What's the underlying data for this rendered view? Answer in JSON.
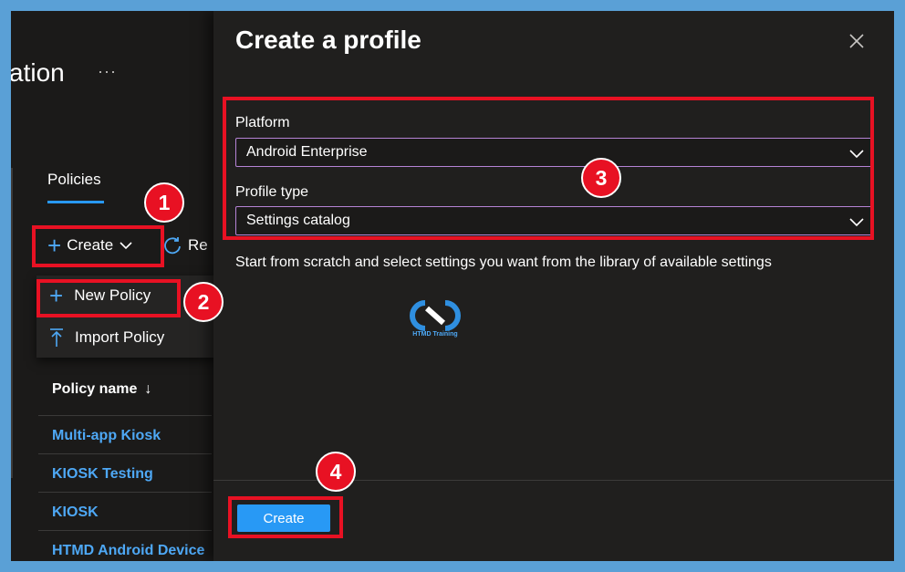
{
  "background": {
    "page_title_fragment": "ation",
    "ellipsis": "···",
    "tab_policies": "Policies",
    "create_menu_label": "Create",
    "refresh_label": "Re",
    "menu": {
      "new_policy": "New Policy",
      "import_policy": "Import Policy"
    },
    "table": {
      "column_header": "Policy name",
      "sort_indicator": "↓",
      "rows": [
        "Multi-app Kiosk",
        "KIOSK Testing",
        "KIOSK",
        "HTMD Android Device"
      ]
    }
  },
  "blade": {
    "title": "Create a profile",
    "close_icon": "close-icon",
    "platform": {
      "label": "Platform",
      "value": "Android Enterprise"
    },
    "profile_type": {
      "label": "Profile type",
      "value": "Settings catalog"
    },
    "helper_text": "Start from scratch and select settings you want from the library of available settings",
    "watermark_text": "HTMD Training",
    "create_button": "Create"
  },
  "annotations": [
    "1",
    "2",
    "3",
    "4"
  ],
  "colors": {
    "accent": "#2899f5",
    "link": "#4ea8f5",
    "highlight": "#e81123",
    "select_border": "#b583d6",
    "frame_border": "#5aa0d6"
  }
}
